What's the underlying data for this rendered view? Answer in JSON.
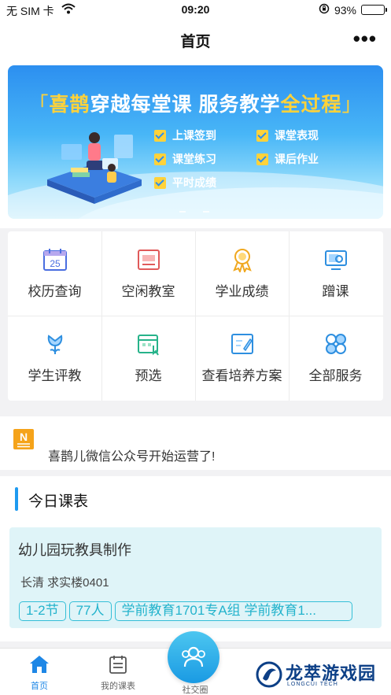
{
  "status_bar": {
    "carrier": "无 SIM 卡",
    "time": "09:20",
    "battery": "93%",
    "battery_level": 0.93
  },
  "nav": {
    "title": "首页",
    "more_label": "•••"
  },
  "banner": {
    "headline_open": "「",
    "headline_a": "喜鹊",
    "headline_b": "穿越每堂课 服务教学",
    "headline_c": "全过程",
    "headline_close": "」",
    "features": [
      "上课签到",
      "课堂表现",
      "课堂练习",
      "课后作业",
      "平时成绩"
    ]
  },
  "services": [
    {
      "label": "校历查询",
      "icon": "calendar-icon",
      "icon_text": "25"
    },
    {
      "label": "空闲教室",
      "icon": "classroom-icon"
    },
    {
      "label": "学业成绩",
      "icon": "award-icon"
    },
    {
      "label": "蹭课",
      "icon": "audit-class-icon"
    },
    {
      "label": "学生评教",
      "icon": "evaluation-icon"
    },
    {
      "label": "预选",
      "icon": "preselect-icon"
    },
    {
      "label": "查看培养方案",
      "icon": "training-plan-icon"
    },
    {
      "label": "全部服务",
      "icon": "all-services-icon"
    }
  ],
  "notice": {
    "icon_letter": "N",
    "text": "喜鹊儿微信公众号开始运营了!"
  },
  "schedule": {
    "title": "今日课表",
    "course": {
      "name": "幼儿园玩教具制作",
      "location": "长清  求实楼0401",
      "tags": [
        "1-2节",
        "77人",
        "学前教育1701专A组 学前教育1..."
      ]
    }
  },
  "tabbar": {
    "home": "首页",
    "my_courses": "我的课表",
    "social": "社交圈"
  },
  "watermark": {
    "text": "龙萃游戏园",
    "sub": "LONGCUI TECH"
  },
  "colors": {
    "accent": "#1e87e6",
    "tag": "#34bfd7",
    "highlight": "#ffd23a"
  }
}
